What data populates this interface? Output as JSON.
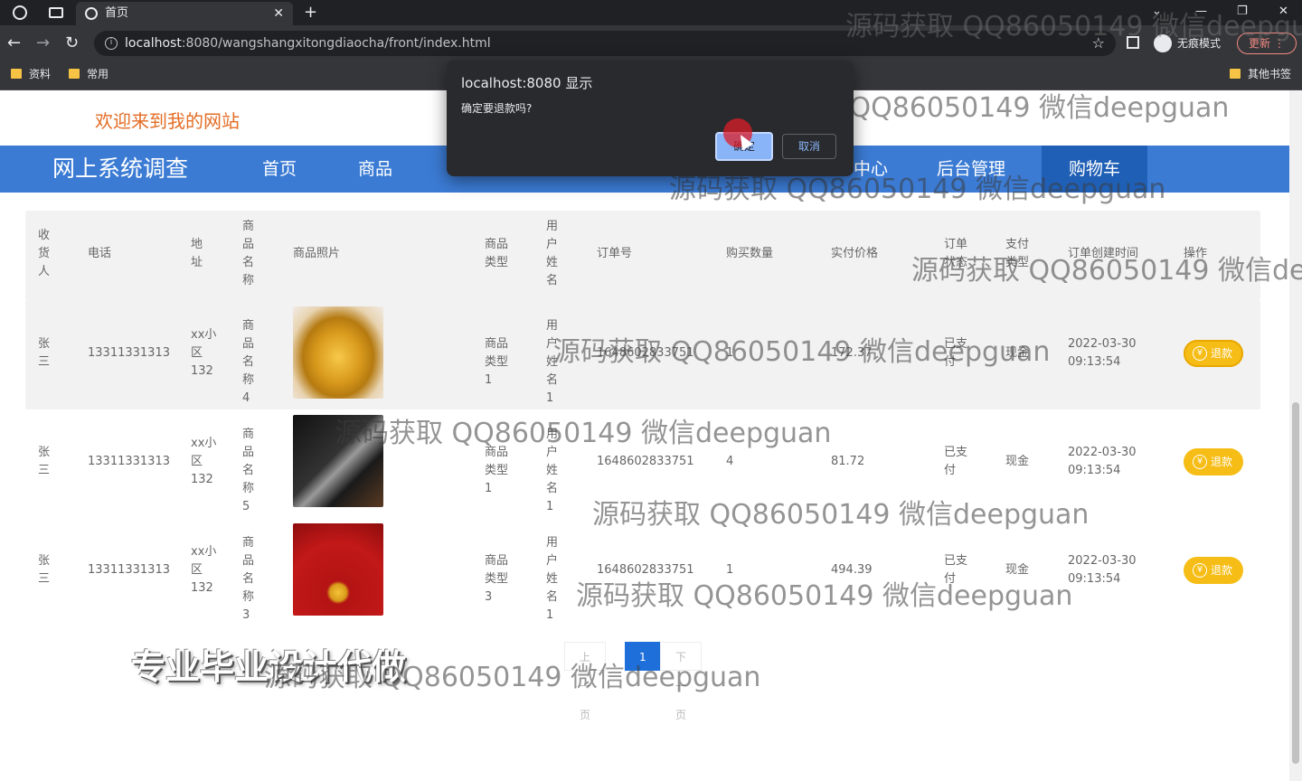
{
  "browser": {
    "tab_title": "首页",
    "new_tab": "+",
    "url_host": "localhost",
    "url_rest": ":8080/wangshangxitongdiaocha/front/index.html",
    "incognito_label": "无痕模式",
    "update_label": "更新",
    "bookmarks": [
      "资料",
      "常用"
    ],
    "other_bookmarks": "其他书签"
  },
  "site": {
    "welcome": "欢迎来到我的网站",
    "brand": "网上系统调查",
    "nav": [
      "首页",
      "商品",
      "中心",
      "后台管理",
      "购物车"
    ]
  },
  "table": {
    "headers": [
      "收货人",
      "电话",
      "地址",
      "商品名称",
      "商品照片",
      "商品类型",
      "用户姓名",
      "订单号",
      "购买数量",
      "实付价格",
      "订单状态",
      "支付类型",
      "订单创建时间",
      "操作"
    ],
    "rows": [
      {
        "name": "张三",
        "phone": "13311331313",
        "addr": "xx小区132",
        "product": "商品名称4",
        "image": "bangle",
        "type": "商品类型1",
        "user": "用户姓名1",
        "order": "1648602833751",
        "qty": "1",
        "price": "172.37",
        "status": "已支付",
        "pay": "现金",
        "time": "2022-03-30 09:13:54",
        "action": "退款"
      },
      {
        "name": "张三",
        "phone": "13311331313",
        "addr": "xx小区132",
        "product": "商品名称5",
        "image": "laptop",
        "type": "商品类型1",
        "user": "用户姓名1",
        "order": "1648602833751",
        "qty": "4",
        "price": "81.72",
        "status": "已支付",
        "pay": "现金",
        "time": "2022-03-30 09:13:54",
        "action": "退款"
      },
      {
        "name": "张三",
        "phone": "13311331313",
        "addr": "xx小区132",
        "product": "商品名称3",
        "image": "necklace",
        "type": "商品类型3",
        "user": "用户姓名1",
        "order": "1648602833751",
        "qty": "1",
        "price": "494.39",
        "status": "已支付",
        "pay": "现金",
        "time": "2022-03-30 09:13:54",
        "action": "退款"
      }
    ]
  },
  "pager": {
    "prev": "上一页",
    "current": "1",
    "next": "下一页"
  },
  "dialog": {
    "title": "localhost:8080 显示",
    "message": "确定要退款吗?",
    "ok": "确定",
    "cancel": "取消"
  },
  "watermark": "源码获取 QQ86050149 微信deepguan",
  "promo": "专业毕业设计代做"
}
